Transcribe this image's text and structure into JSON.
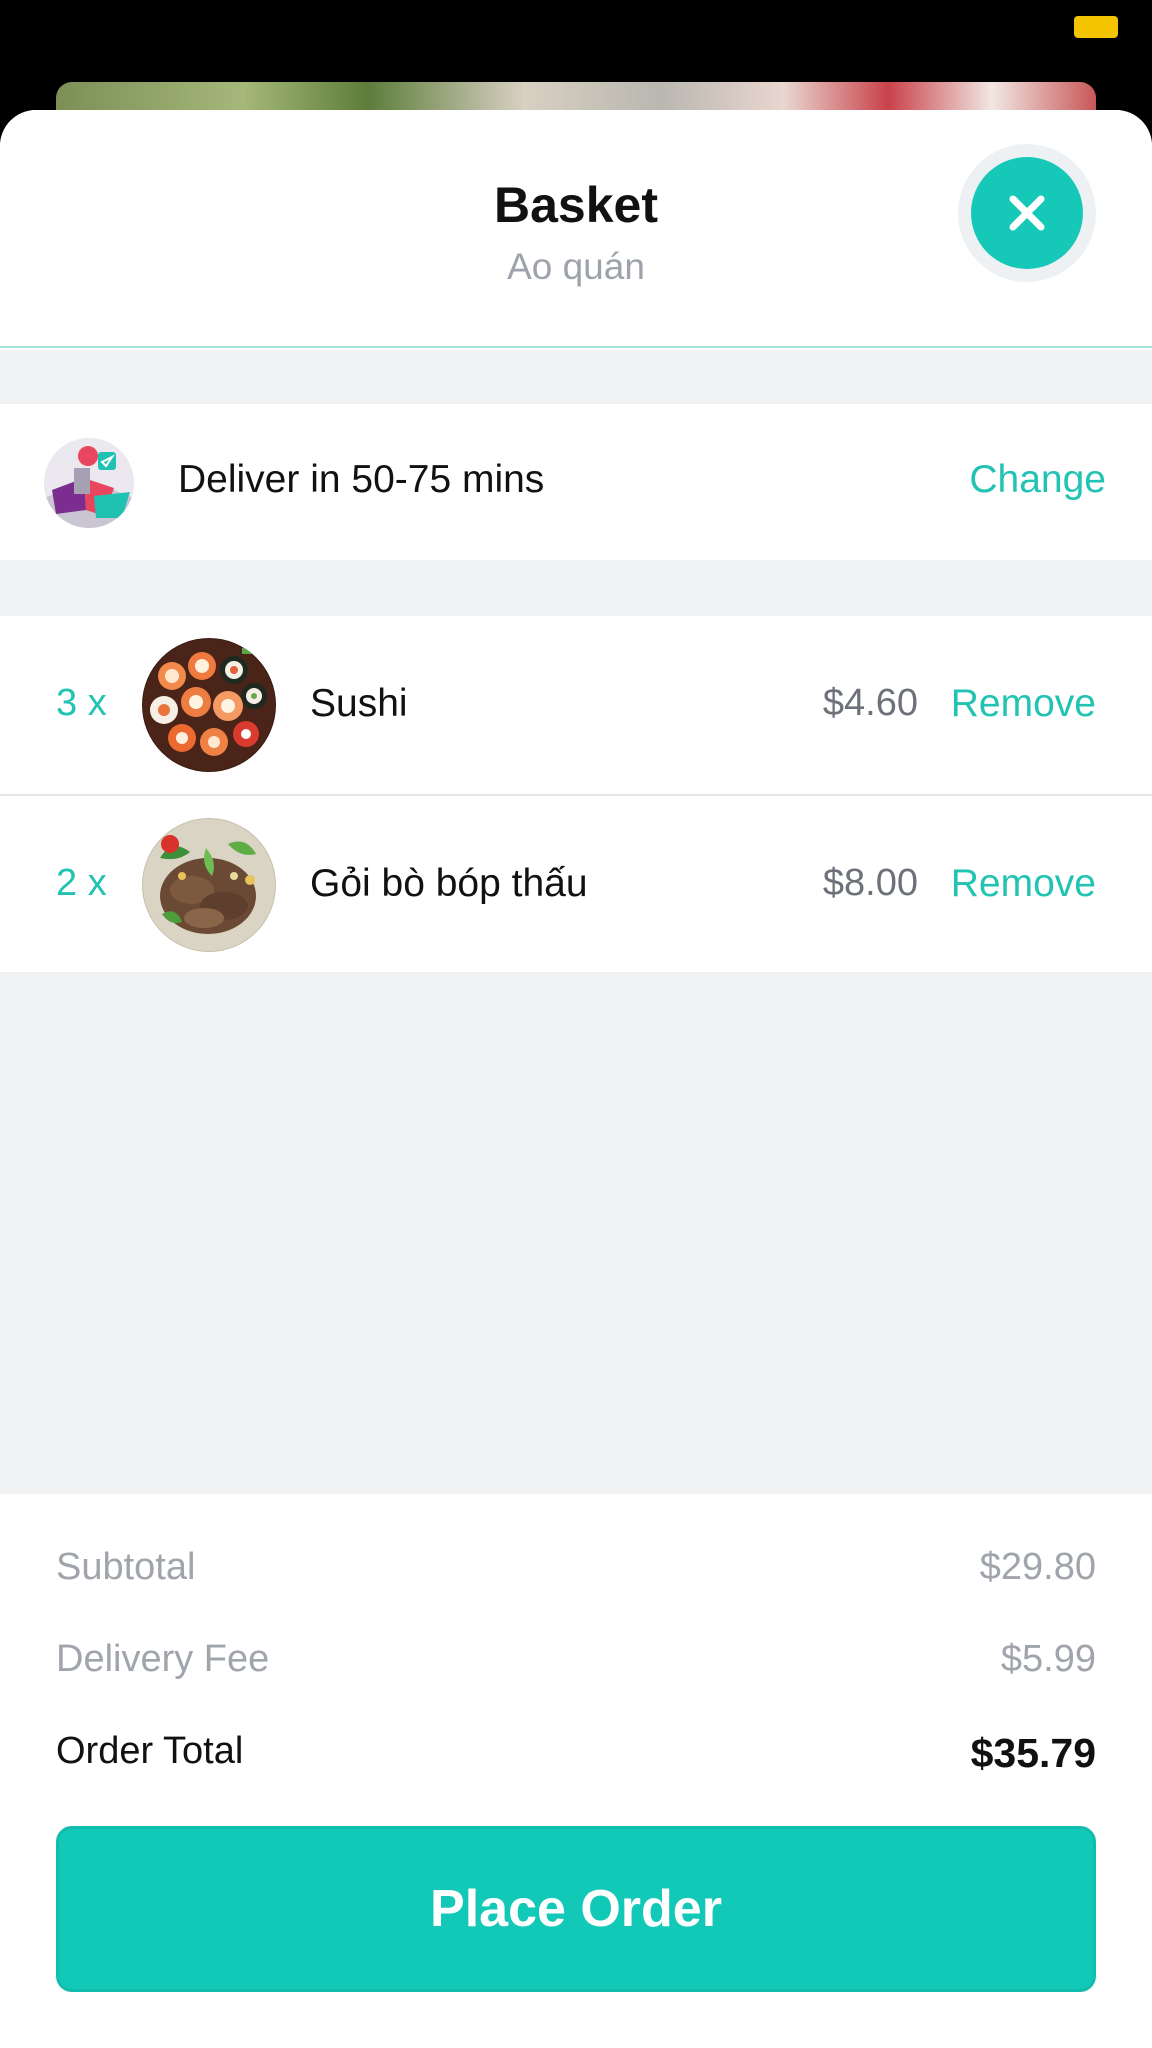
{
  "header": {
    "title": "Basket",
    "subtitle": "Ao quán",
    "close_icon": "close-icon"
  },
  "delivery": {
    "text": "Deliver in 50-75 mins",
    "change_label": "Change",
    "icon": "delivery-courier-icon"
  },
  "items": [
    {
      "qty": "3 x",
      "name": "Sushi",
      "price": "$4.60",
      "remove_label": "Remove",
      "image": "sushi-platter"
    },
    {
      "qty": "2 x",
      "name": "Gỏi bò bóp thấu",
      "price": "$8.00",
      "remove_label": "Remove",
      "image": "beef-salad"
    }
  ],
  "summary": {
    "subtotal_label": "Subtotal",
    "subtotal_value": "$29.80",
    "delivery_fee_label": "Delivery Fee",
    "delivery_fee_value": "$5.99",
    "total_label": "Order Total",
    "total_value": "$35.79"
  },
  "place_order_label": "Place Order",
  "colors": {
    "accent": "#12c9b8",
    "muted_text": "#a0a4ab",
    "background_gray": "#f1f2f4",
    "battery": "#f5c400"
  }
}
